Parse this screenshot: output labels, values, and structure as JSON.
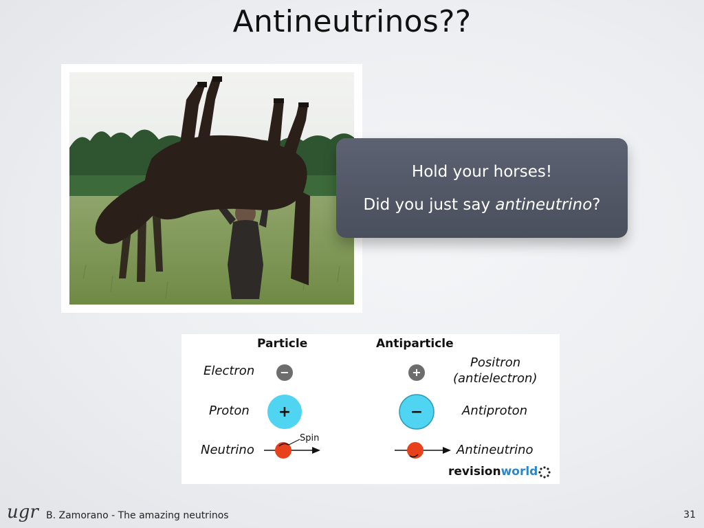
{
  "slide": {
    "title": "Antineutrinos??",
    "page_number": "31"
  },
  "callout": {
    "line1": "Hold your horses!",
    "line2_prefix": "Did you just say ",
    "line2_emphasis": "antineutrino",
    "line2_suffix": "?"
  },
  "particles_table": {
    "header_particle": "Particle",
    "header_antiparticle": "Antiparticle",
    "rows": [
      {
        "particle": "Electron",
        "particle_sign": "−",
        "antiparticle_sign": "+",
        "antiparticle_line1": "Positron",
        "antiparticle_line2": "(antielectron)"
      },
      {
        "particle": "Proton",
        "particle_sign": "+",
        "antiparticle_sign": "−",
        "antiparticle_line1": "Antiproton"
      },
      {
        "particle": "Neutrino",
        "antiparticle_line1": "Antineutrino"
      }
    ],
    "spin_label": "Spin",
    "brand_bold": "revision",
    "brand_color": "world",
    "colors": {
      "electron_fill": "#6d6d6d",
      "proton_fill": "#4fd4f2",
      "neutrino_fill": "#e8421c",
      "brand_blue": "#2d86c8"
    }
  },
  "footer": {
    "logo": "ugr",
    "text": "B. Zamorano - The amazing neutrinos"
  }
}
